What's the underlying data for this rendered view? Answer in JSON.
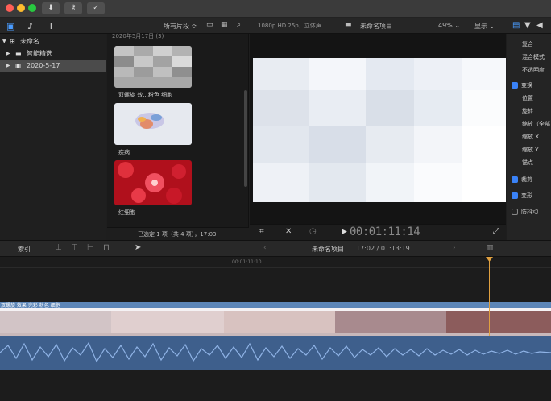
{
  "toolbar": {
    "filter_label": "所有片段 ≎",
    "format_info": "1080p HD 25p，立体声",
    "project_name": "未命名项目",
    "zoom": "49% ⌄",
    "view_label": "显示 ⌄"
  },
  "library": {
    "items": [
      {
        "label": "未命名",
        "icon": "library-icon"
      },
      {
        "label": "智能精选",
        "icon": "folder-icon"
      },
      {
        "label": "2020-5-17",
        "icon": "event-icon"
      }
    ]
  },
  "browser": {
    "date_header": "2020年5月17日  (3)",
    "clips": [
      {
        "label": "双螺旋 效...粉色 细胞"
      },
      {
        "label": "疾病"
      },
      {
        "label": "红细胞"
      }
    ],
    "status": "已选定 1 项（共 4 项），17:03"
  },
  "viewer": {
    "timecode": "00:01:11:14"
  },
  "inspector": {
    "rows": [
      {
        "label": "复合",
        "check": "none"
      },
      {
        "label": "混合模式",
        "check": "none"
      },
      {
        "label": "不透明度",
        "check": "none"
      },
      {
        "label": "变换",
        "check": "on"
      },
      {
        "label": "位置",
        "check": "none"
      },
      {
        "label": "旋转",
        "check": "none"
      },
      {
        "label": "缩放（全部",
        "check": "none"
      },
      {
        "label": "缩放 X",
        "check": "none"
      },
      {
        "label": "缩放 Y",
        "check": "none"
      },
      {
        "label": "锚点",
        "check": "none"
      },
      {
        "label": "裁剪",
        "check": "on"
      },
      {
        "label": "变形",
        "check": "on"
      },
      {
        "label": "防抖动",
        "check": "off"
      }
    ]
  },
  "timeline": {
    "index_label": "索引",
    "project_name": "未命名项目",
    "duration": "17:02 / 01:13:19",
    "ruler_time": "00:01:11:10",
    "clip_label": "双螺旋 效果 亮彩 粉色 细胞"
  },
  "colors": {
    "accent": "#3a82f7",
    "playhead": "#e0a040",
    "audio": "#4a6e9c"
  }
}
